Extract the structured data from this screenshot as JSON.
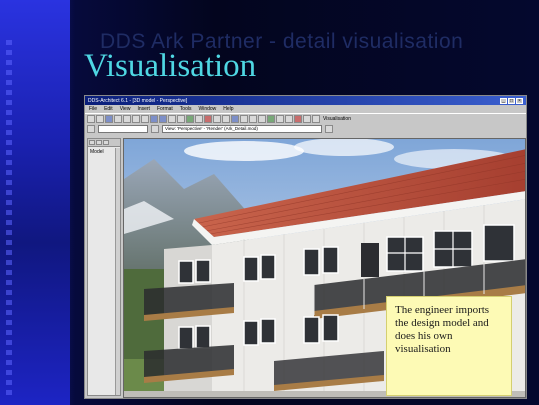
{
  "slide": {
    "bg_title": "DDS Ark Partner - detail visualisation",
    "title": "Visualisation",
    "callout": "The engineer imports the design model and does his own visualisation"
  },
  "app": {
    "window_title": "DDS-Architect 6.1 - [3D model - Perspective]",
    "menus": [
      "File",
      "Edit",
      "View",
      "Insert",
      "Format",
      "Tools",
      "Window",
      "Help"
    ],
    "toolbar_label": "Visualisation",
    "view_combo": "View: 'Perspective' - 'Render' (Ark_Detail.mod)",
    "side_panel_label": "Model"
  },
  "colors": {
    "title": "#4fd7e3",
    "callout_bg": "#fdfab5",
    "roof": "#b34a36",
    "facade": "#eeeeec"
  },
  "icons": [
    "window-minimize-icon",
    "window-maximize-icon",
    "window-close-icon"
  ]
}
